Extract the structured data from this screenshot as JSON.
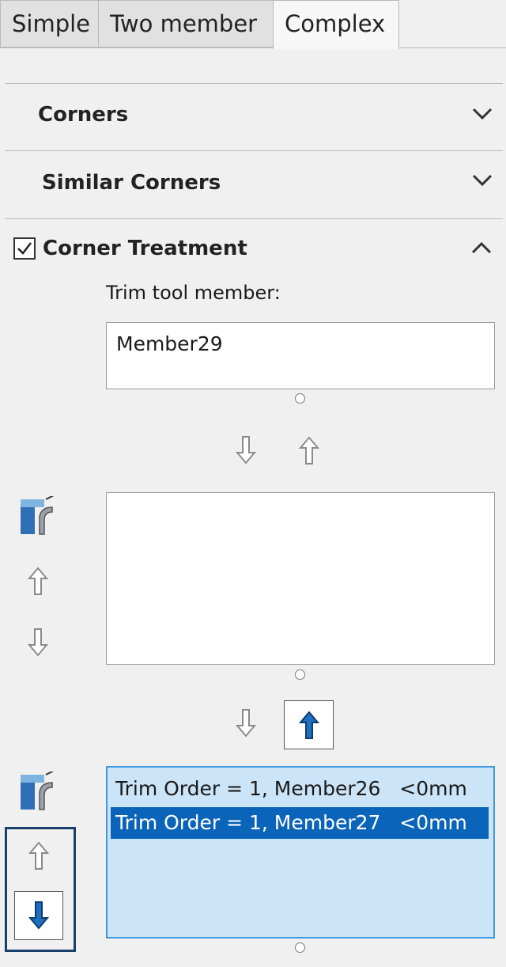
{
  "tabs": [
    "Simple",
    "Two member",
    "Complex"
  ],
  "sections": {
    "corners": "Corners",
    "similar_corners": "Similar Corners",
    "corner_treatment": "Corner Treatment",
    "corner_treatment_checked": true
  },
  "trim": {
    "label": "Trim tool member:",
    "value": "Member29"
  },
  "order_list": [
    {
      "text": "Trim Order = 1, Member26   <0mm",
      "selected": false
    },
    {
      "text": "Trim Order = 1, Member27   <0mm",
      "selected": true
    }
  ],
  "colors": {
    "accent": "#0a64b9",
    "selection_bg": "#cce4f7",
    "arrow_blue": "#1f6fc0",
    "frame_navy": "#1b3f6d"
  },
  "icons": [
    "chevron-down-icon",
    "chevron-up-icon",
    "checkbox-icon",
    "arrow-down-icon",
    "arrow-up-icon",
    "corner-trim-icon"
  ]
}
